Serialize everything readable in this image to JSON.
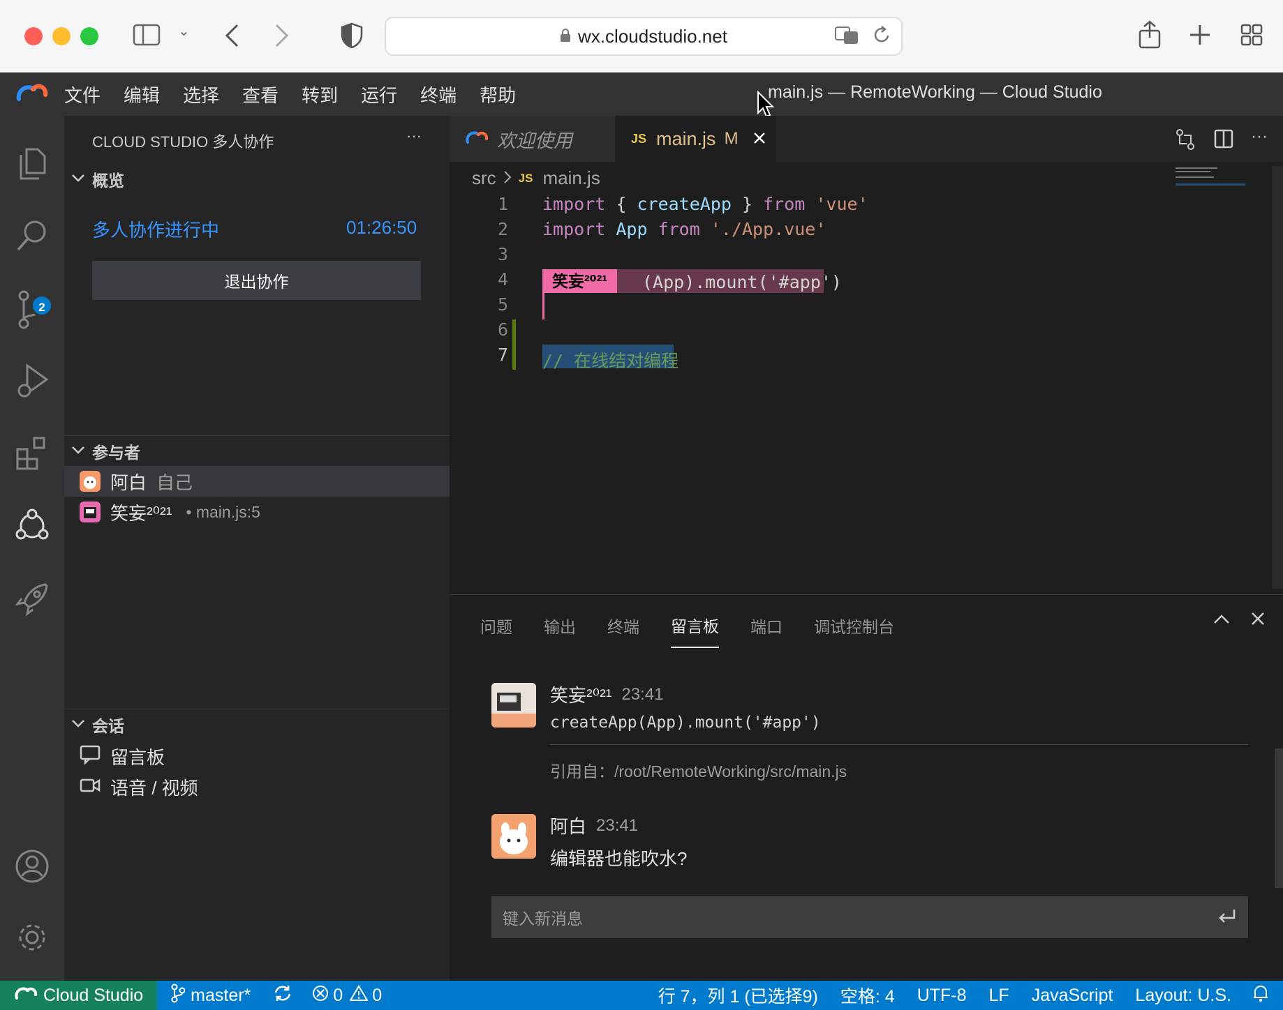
{
  "browser": {
    "url": "wx.cloudstudio.net",
    "colors": {
      "close": "#ff5f57",
      "minimize": "#febc2e",
      "maximize": "#28c840"
    }
  },
  "titlebar": {
    "menu": [
      "文件",
      "编辑",
      "选择",
      "查看",
      "转到",
      "运行",
      "终端",
      "帮助"
    ],
    "title": "main.js — RemoteWorking — Cloud Studio"
  },
  "activity": {
    "icons": [
      "files-icon",
      "search-icon",
      "source-control-icon",
      "run-debug-icon",
      "extensions-icon",
      "collaboration-icon",
      "rocket-icon",
      "account-icon",
      "settings-gear-icon"
    ],
    "scm_badge": "2"
  },
  "sidebar": {
    "title": "CLOUD STUDIO 多人协作",
    "more": "···",
    "overview": {
      "header": "概览",
      "status": "多人协作进行中",
      "timer": "01:26:50",
      "exit_button": "退出协作"
    },
    "participants": {
      "header": "参与者",
      "items": [
        {
          "name": "阿白",
          "note": "自己",
          "location": ""
        },
        {
          "name": "笑妄²⁰²¹",
          "note": "",
          "location": "• main.js:5"
        }
      ]
    },
    "session": {
      "header": "会话",
      "items": [
        {
          "label": "留言板"
        },
        {
          "label": "语音 / 视频"
        }
      ]
    }
  },
  "editor": {
    "tabs": [
      {
        "label": "欢迎使用"
      },
      {
        "label": "main.js",
        "status": "M",
        "lang": "JS"
      }
    ],
    "breadcrumb": {
      "folder": "src",
      "file": "main.js",
      "lang": "JS"
    },
    "line_numbers": [
      "1",
      "2",
      "3",
      "4",
      "5",
      "6",
      "7"
    ],
    "code": {
      "l1": {
        "kw1": "import",
        "p1": " { ",
        "id": "createApp",
        "p2": " } ",
        "kw2": "from",
        "str": " 'vue'"
      },
      "l2": {
        "kw1": "import",
        "cls": " App ",
        "kw2": "from",
        "str": " './App.vue'"
      },
      "l4": {
        "cursor_label": "笑妄²⁰²¹",
        "rest": "(App).mount('#app')"
      },
      "l7": {
        "comment": "// 在线结对编程"
      }
    },
    "colors": {
      "remote_cursor": "#f06aa8",
      "selection": "#264f78"
    }
  },
  "panel": {
    "tabs": [
      "问题",
      "输出",
      "终端",
      "留言板",
      "端口",
      "调试控制台"
    ],
    "active_tab": "留言板",
    "messages": [
      {
        "author": "笑妄²⁰²¹",
        "time": "23:41",
        "code": "createApp(App).mount('#app')",
        "quote": "引用自：/root/RemoteWorking/src/main.js"
      },
      {
        "author": "阿白",
        "time": "23:41",
        "text": "编辑器也能吹水?"
      }
    ],
    "input_placeholder": "键入新消息"
  },
  "status": {
    "brand": "Cloud Studio",
    "branch": "master*",
    "errors": "0",
    "warnings": "0",
    "position": "行 7，列 1 (已选择9)",
    "spaces": "空格: 4",
    "encoding": "UTF-8",
    "eol": "LF",
    "language": "JavaScript",
    "layout": "Layout: U.S."
  }
}
